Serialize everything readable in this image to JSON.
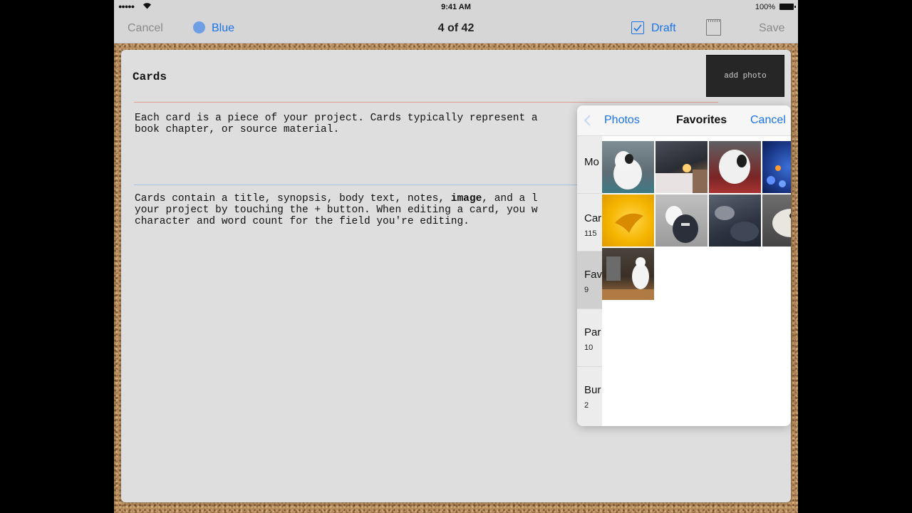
{
  "status": {
    "signal": "●●●●●",
    "time": "9:41 AM",
    "battery": "100%"
  },
  "nav": {
    "cancel": "Cancel",
    "color": "Blue",
    "counter": "4 of 42",
    "draft": "Draft",
    "save": "Save"
  },
  "card": {
    "title": "Cards",
    "add_photo": "add photo",
    "synopsis": "Each card is a piece of your project. Cards typically represent a\nbook chapter, or source material.",
    "body": {
      "line1_a": "Cards contain a title, synopsis, body text, notes, ",
      "line1_bold": "image",
      "line1_b": ", and a l",
      "line2": "your project by touching the + button. When editing a card, you w",
      "line3": "character and word count for the field you're editing."
    }
  },
  "photos": {
    "back": "Photos",
    "title": "Favorites",
    "cancel": "Cancel",
    "albums": [
      {
        "name": "Mo",
        "count": ""
      },
      {
        "name": "Car",
        "count": "115"
      },
      {
        "name": "Fav",
        "count": "9"
      },
      {
        "name": "Par",
        "count": "10"
      },
      {
        "name": "Bur",
        "count": "2"
      }
    ]
  },
  "colors": {
    "accent": "#1a73e8",
    "dot": "#6e9fe4"
  }
}
